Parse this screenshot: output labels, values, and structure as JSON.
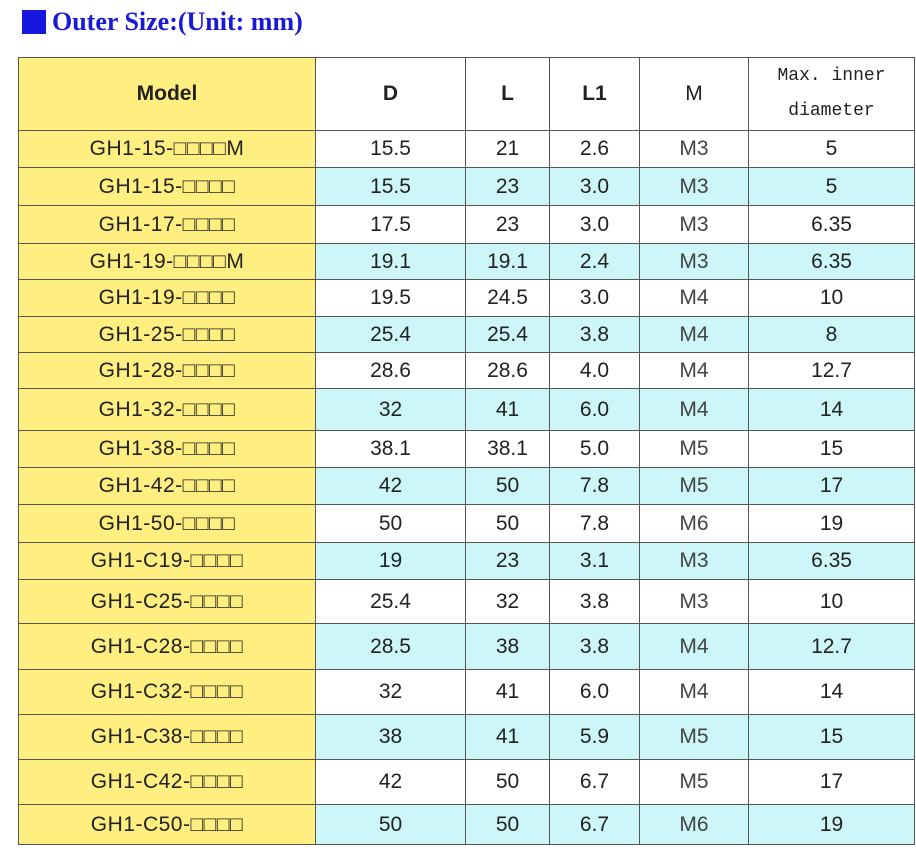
{
  "header": {
    "title": "Outer Size:(Unit: mm)",
    "color": "#1818d8"
  },
  "colors": {
    "model_column": "#ffee80",
    "alt_row": "#ccf6f8"
  },
  "table": {
    "headers": {
      "model": "Model",
      "d": "D",
      "l": "L",
      "l1": "L1",
      "m": "M",
      "max_line1": "Max. inner",
      "max_line2": "diameter"
    },
    "rows": [
      {
        "model": "GH1-15-□□□□M",
        "d": "15.5",
        "l": "21",
        "l1": "2.6",
        "m": "M3",
        "max": "5"
      },
      {
        "model": "GH1-15-□□□□",
        "d": "15.5",
        "l": "23",
        "l1": "3.0",
        "m": "M3",
        "max": "5"
      },
      {
        "model": "GH1-17-□□□□",
        "d": "17.5",
        "l": "23",
        "l1": "3.0",
        "m": "M3",
        "max": "6.35"
      },
      {
        "model": "GH1-19-□□□□M",
        "d": "19.1",
        "l": "19.1",
        "l1": "2.4",
        "m": "M3",
        "max": "6.35"
      },
      {
        "model": "GH1-19-□□□□",
        "d": "19.5",
        "l": "24.5",
        "l1": "3.0",
        "m": "M4",
        "max": "10"
      },
      {
        "model": "GH1-25-□□□□",
        "d": "25.4",
        "l": "25.4",
        "l1": "3.8",
        "m": "M4",
        "max": "8"
      },
      {
        "model": "GH1-28-□□□□",
        "d": "28.6",
        "l": "28.6",
        "l1": "4.0",
        "m": "M4",
        "max": "12.7"
      },
      {
        "model": "GH1-32-□□□□",
        "d": "32",
        "l": "41",
        "l1": "6.0",
        "m": "M4",
        "max": "14"
      },
      {
        "model": "GH1-38-□□□□",
        "d": "38.1",
        "l": "38.1",
        "l1": "5.0",
        "m": "M5",
        "max": "15"
      },
      {
        "model": "GH1-42-□□□□",
        "d": "42",
        "l": "50",
        "l1": "7.8",
        "m": "M5",
        "max": "17"
      },
      {
        "model": "GH1-50-□□□□",
        "d": "50",
        "l": "50",
        "l1": "7.8",
        "m": "M6",
        "max": "19"
      },
      {
        "model": "GH1-C19-□□□□",
        "d": "19",
        "l": "23",
        "l1": "3.1",
        "m": "M3",
        "max": "6.35"
      },
      {
        "model": "GH1-C25-□□□□",
        "d": "25.4",
        "l": "32",
        "l1": "3.8",
        "m": "M3",
        "max": "10"
      },
      {
        "model": "GH1-C28-□□□□",
        "d": "28.5",
        "l": "38",
        "l1": "3.8",
        "m": "M4",
        "max": "12.7"
      },
      {
        "model": "GH1-C32-□□□□",
        "d": "32",
        "l": "41",
        "l1": "6.0",
        "m": "M4",
        "max": "14"
      },
      {
        "model": "GH1-C38-□□□□",
        "d": "38",
        "l": "41",
        "l1": "5.9",
        "m": "M5",
        "max": "15"
      },
      {
        "model": "GH1-C42-□□□□",
        "d": "42",
        "l": "50",
        "l1": "6.7",
        "m": "M5",
        "max": "17"
      },
      {
        "model": "GH1-C50-□□□□",
        "d": "50",
        "l": "50",
        "l1": "6.7",
        "m": "M6",
        "max": "19"
      }
    ]
  }
}
